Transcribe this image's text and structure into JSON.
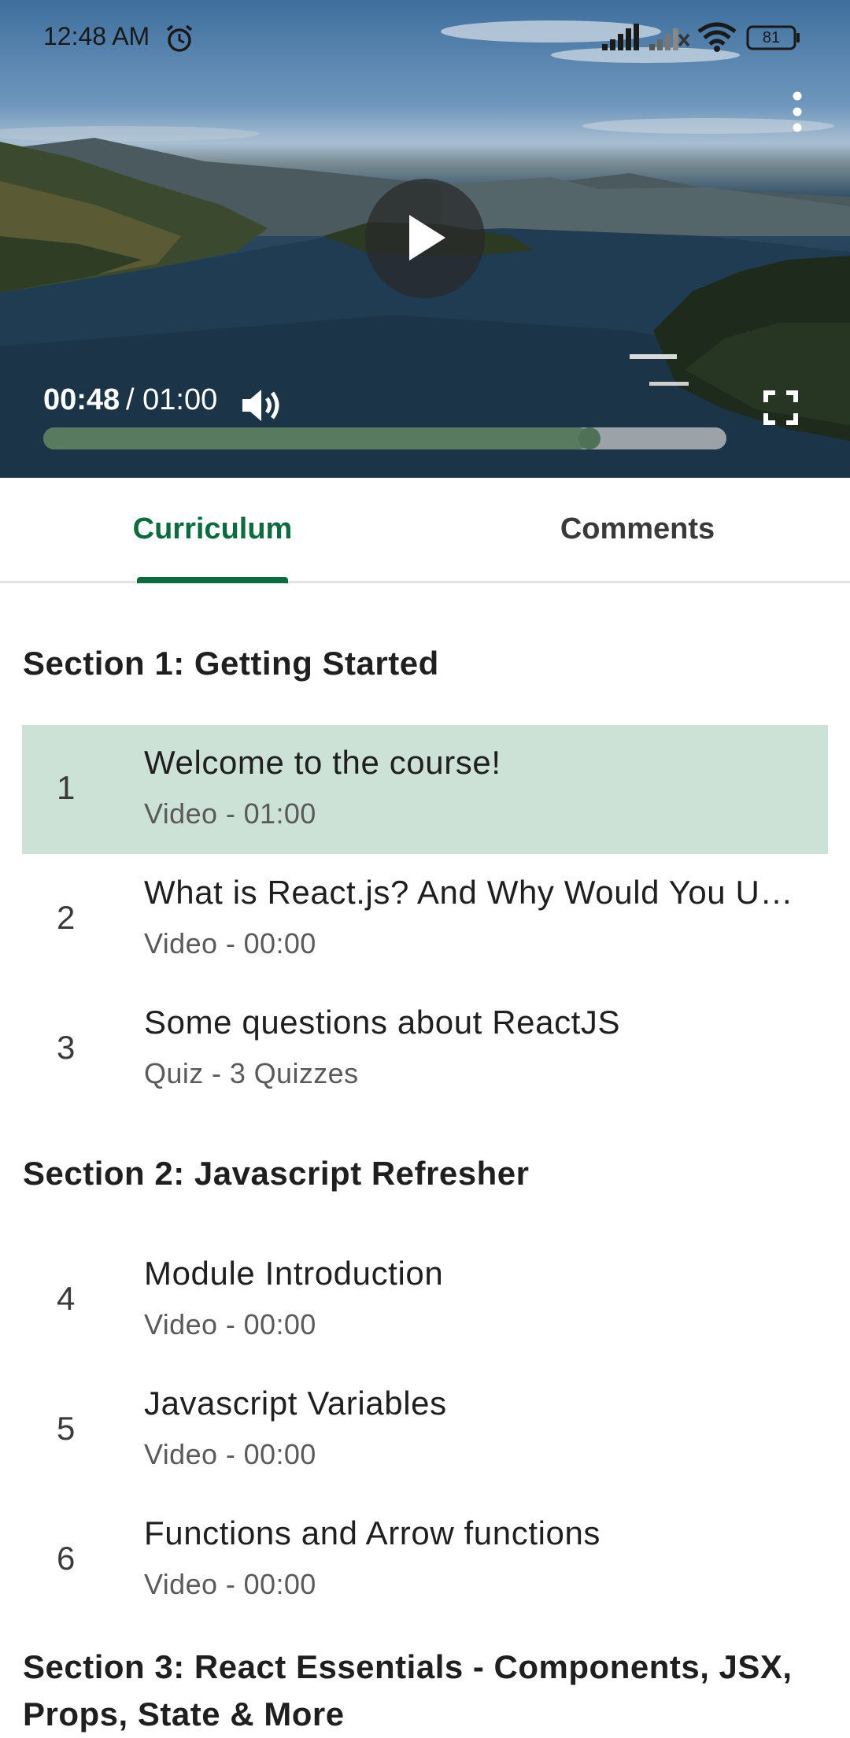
{
  "status_bar": {
    "time": "12:48 AM",
    "battery": "81",
    "icons": [
      "alarm-icon",
      "signal-icon",
      "signal-no-service-icon",
      "wifi-icon",
      "battery-icon"
    ]
  },
  "player": {
    "current_time": "00:48",
    "total_time": "/ 01:00",
    "progress_fraction": 0.8,
    "icons": [
      "play-icon",
      "volume-icon",
      "fullscreen-icon",
      "more-vert-icon"
    ]
  },
  "tabs": [
    {
      "label": "Curriculum",
      "active": true
    },
    {
      "label": "Comments",
      "active": false
    }
  ],
  "sections": [
    {
      "title": "Section 1: Getting Started",
      "lessons": [
        {
          "num": "1",
          "title": "Welcome to the course!",
          "subtitle": "Video - 01:00",
          "active": true
        },
        {
          "num": "2",
          "title": "What is React.js? And Why Would You Use It?",
          "subtitle": "Video - 00:00",
          "active": false
        },
        {
          "num": "3",
          "title": "Some questions about ReactJS",
          "subtitle": "Quiz - 3 Quizzes",
          "active": false
        }
      ]
    },
    {
      "title": "Section 2: Javascript Refresher",
      "lessons": [
        {
          "num": "4",
          "title": "Module Introduction",
          "subtitle": "Video - 00:00",
          "active": false
        },
        {
          "num": "5",
          "title": "Javascript Variables",
          "subtitle": "Video - 00:00",
          "active": false
        },
        {
          "num": "6",
          "title": "Functions and Arrow functions",
          "subtitle": "Video - 00:00",
          "active": false
        }
      ]
    },
    {
      "title": "Section 3: React Essentials - Components, JSX, Props, State & More",
      "lessons": []
    }
  ],
  "colors": {
    "accent": "#0e6b3f",
    "active_row": "#cde2d6",
    "progress_fill": "#587a5f"
  }
}
